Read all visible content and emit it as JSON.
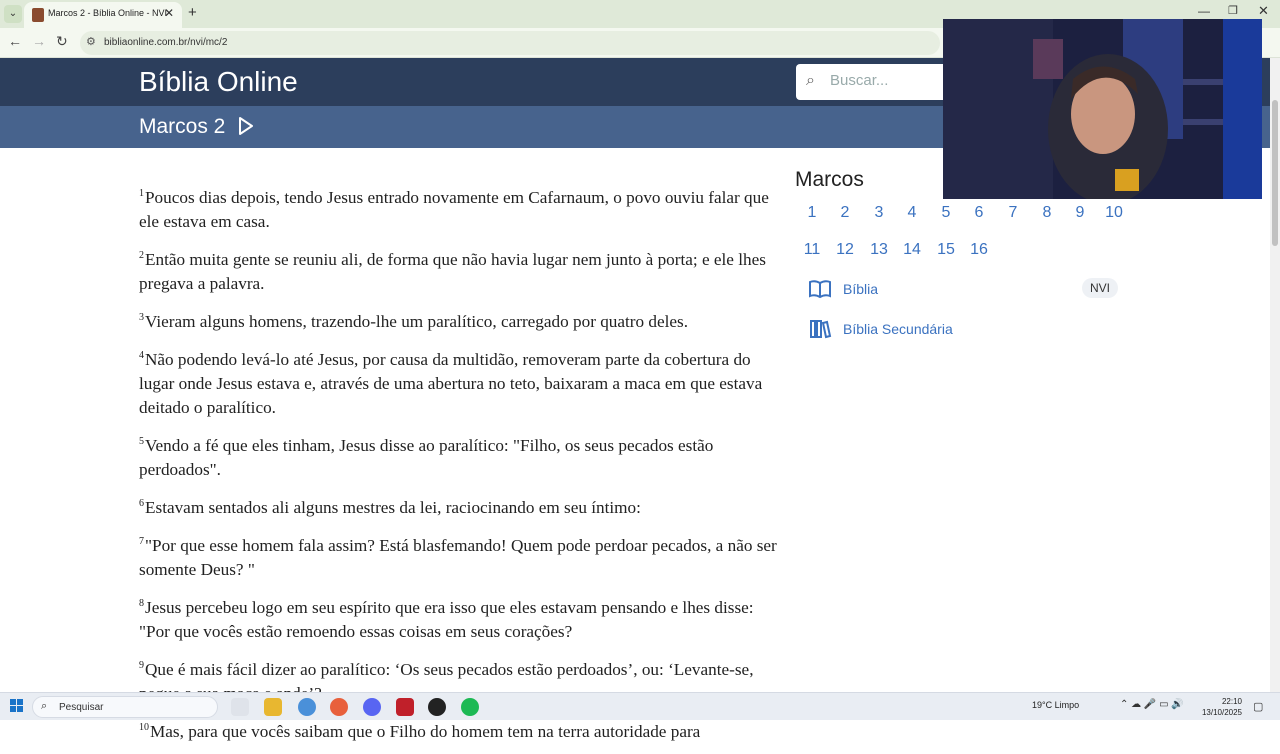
{
  "browser": {
    "tab_title": "Marcos 2 - Bíblia Online - NVI",
    "url": "bibliaonline.com.br/nvi/mc/2"
  },
  "site": {
    "title": "Bíblia Online",
    "search_placeholder": "Buscar...",
    "chapter_title": "Marcos 2"
  },
  "verses": [
    {
      "num": "1",
      "text": "Poucos dias depois, tendo Jesus entrado novamente em Cafarnaum, o povo ouviu falar que ele estava em casa."
    },
    {
      "num": "2",
      "text": "Então muita gente se reuniu ali, de forma que não havia lugar nem junto à porta; e ele lhes pregava a palavra."
    },
    {
      "num": "3",
      "text": "Vieram alguns homens, trazendo-lhe um paralítico, carregado por quatro deles."
    },
    {
      "num": "4",
      "text": "Não podendo levá-lo até Jesus, por causa da multidão, removeram parte da cobertura do lugar onde Jesus estava e, através de uma abertura no teto, baixaram a maca em que estava deitado o paralítico."
    },
    {
      "num": "5",
      "text": "Vendo a fé que eles tinham, Jesus disse ao paralítico: \"Filho, os seus pecados estão perdoados\"."
    },
    {
      "num": "6",
      "text": "Estavam sentados ali alguns mestres da lei, raciocinando em seu íntimo:"
    },
    {
      "num": "7",
      "text": "\"Por que esse homem fala assim? Está blasfemando! Quem pode perdoar pecados, a não ser somente Deus? \""
    },
    {
      "num": "8",
      "text": "Jesus percebeu logo em seu espírito que era isso que eles estavam pensando e lhes disse: \"Por que vocês estão remoendo essas coisas em seus corações?"
    },
    {
      "num": "9",
      "text": "Que é mais fácil dizer ao paralítico: ‘Os seus pecados estão perdoados’, ou: ‘Levante-se, pegue a sua maca e ande’?"
    },
    {
      "num": "10",
      "text": "Mas, para que vocês saibam que o Filho do homem tem na terra autoridade para"
    }
  ],
  "sidebar": {
    "book": "Marcos",
    "chapters": [
      "1",
      "2",
      "3",
      "4",
      "5",
      "6",
      "7",
      "8",
      "9",
      "10",
      "11",
      "12",
      "13",
      "14",
      "15",
      "16"
    ],
    "bible_link": "Bíblia",
    "version_badge": "NVI",
    "secondary_link": "Bíblia Secundária"
  },
  "taskbar": {
    "search_label": "Pesquisar",
    "weather": "19°C  Limpo",
    "time": "22:10",
    "date": "13/10/2025"
  },
  "colors": {
    "header": "#2c3e5c",
    "chapter_bar": "#47638d",
    "link": "#3b72c0"
  }
}
